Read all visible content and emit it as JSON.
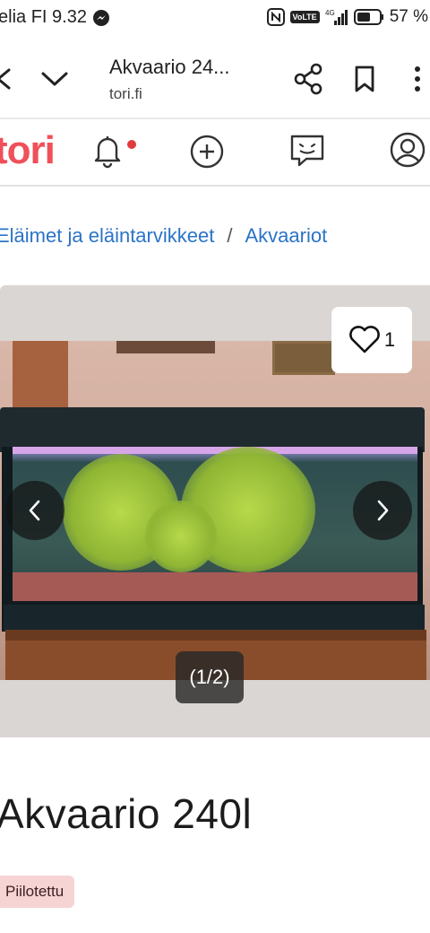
{
  "status_bar": {
    "carrier_time": "elia FI 9.32",
    "battery": "57 %",
    "volte": "VoLTE",
    "network": "4G"
  },
  "browser": {
    "title": "Akvaario 24...",
    "url": "tori.fi"
  },
  "site": {
    "logo": "tori",
    "brand_color": "#f0505a",
    "notification_dot_color": "#e03b3b"
  },
  "breadcrumb": {
    "items": [
      "Eläimet ja eläintarvikkeet",
      "Akvaariot"
    ],
    "separator": "/"
  },
  "gallery": {
    "favorite_count": "1",
    "counter": "(1/2)",
    "current_image": 1,
    "total_images": 2
  },
  "listing": {
    "title": "Akvaario 240l",
    "badge": "Piilotettu",
    "badge_color": "#f7d4d4"
  },
  "link_color": "#2a74c7"
}
